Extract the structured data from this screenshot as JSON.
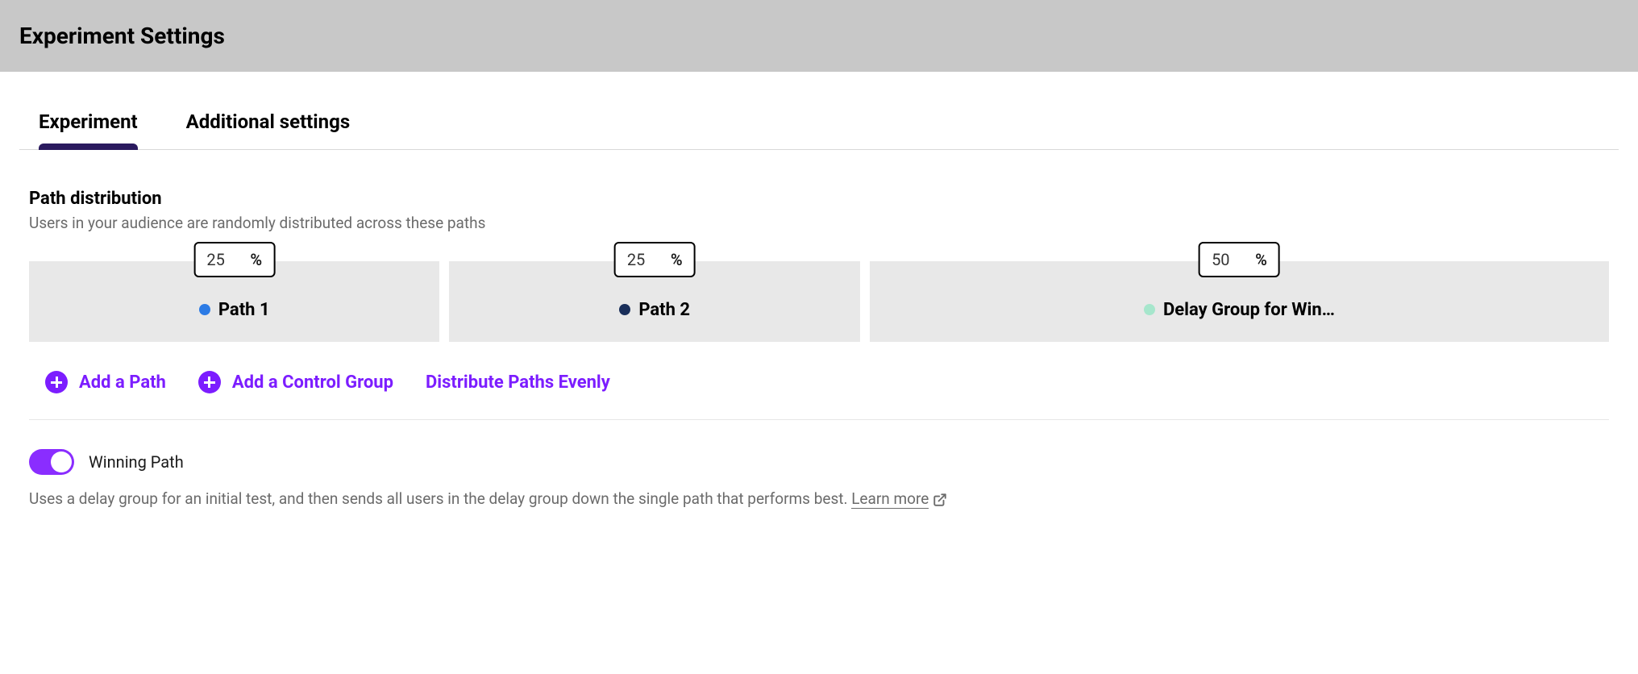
{
  "header": {
    "title": "Experiment Settings"
  },
  "tabs": [
    {
      "label": "Experiment",
      "active": true
    },
    {
      "label": "Additional settings",
      "active": false
    }
  ],
  "pathDistribution": {
    "title": "Path distribution",
    "description": "Users in your audience are randomly distributed across these paths",
    "paths": [
      {
        "percent": "25",
        "label": "Path 1",
        "dotColor": "#2c7be5"
      },
      {
        "percent": "25",
        "label": "Path 2",
        "dotColor": "#1a2f5a"
      },
      {
        "percent": "50",
        "label": "Delay Group for Win…",
        "dotColor": "#a6e6cc"
      }
    ]
  },
  "actions": {
    "addPath": "Add a Path",
    "addControlGroup": "Add a Control Group",
    "distributeEvenly": "Distribute Paths Evenly"
  },
  "winningPath": {
    "label": "Winning Path",
    "description": "Uses a delay group for an initial test, and then sends all users in the delay group down the single path that performs best.",
    "learnMore": "Learn more"
  },
  "percentSymbol": "%"
}
